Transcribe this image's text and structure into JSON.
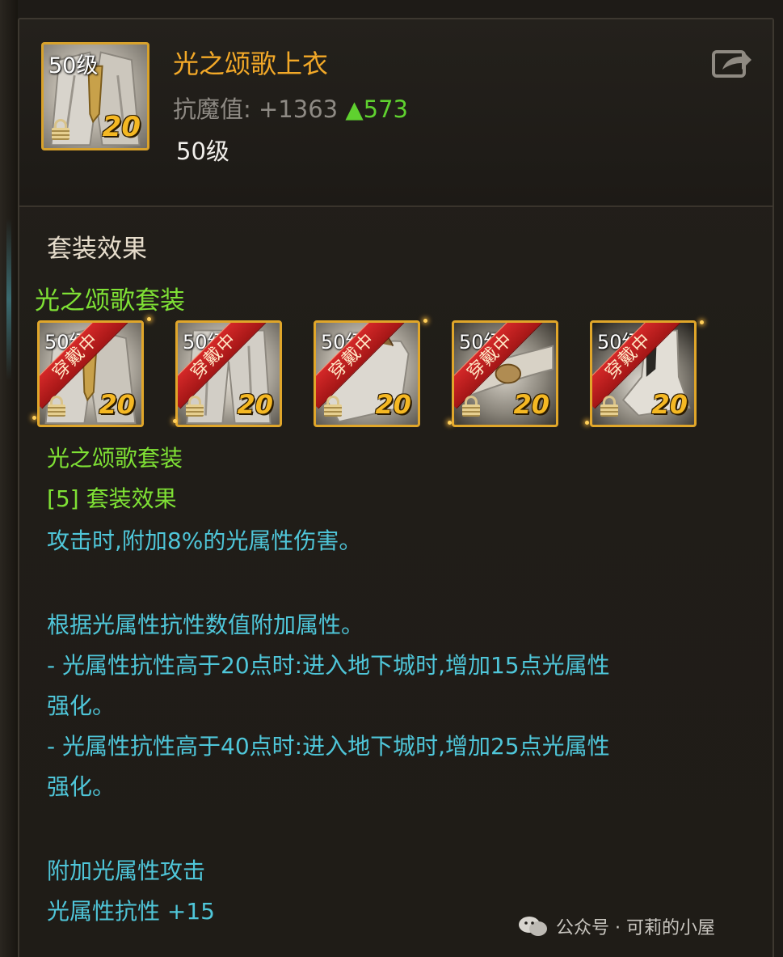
{
  "item": {
    "icon_level": "50级",
    "enhance": "20",
    "name": "光之颂歌上衣",
    "stat_label": "抗魔值:",
    "stat_value": "+1363",
    "stat_delta": "▲573",
    "level": "50级"
  },
  "set_section": {
    "title": "套装效果",
    "set_name": "光之颂歌套装",
    "slots": [
      {
        "level": "50级",
        "badge": "穿戴中",
        "enhance": "20",
        "icon": "coat-icon"
      },
      {
        "level": "50级",
        "badge": "穿戴中",
        "enhance": "20",
        "icon": "pants-icon"
      },
      {
        "level": "50级",
        "badge": "穿戴中",
        "enhance": "20",
        "icon": "shoulder-icon"
      },
      {
        "level": "50级",
        "badge": "穿戴中",
        "enhance": "20",
        "icon": "belt-icon"
      },
      {
        "level": "50级",
        "badge": "穿戴中",
        "enhance": "20",
        "icon": "boots-icon"
      }
    ]
  },
  "description": {
    "set_name": "光之颂歌套装",
    "effect_header": "[5] 套装效果",
    "line1": "攻击时,附加8%的光属性伤害。",
    "line2": "根据光属性抗性数值附加属性。",
    "line3a": "- 光属性抗性高于20点时:进入地下城时,增加15点光属性",
    "line3b": "强化。",
    "line4a": "- 光属性抗性高于40点时:进入地下城时,增加25点光属性",
    "line4b": "强化。",
    "line5": "附加光属性攻击",
    "line6": "光属性抗性 +15"
  },
  "watermark": {
    "text": "公众号 · 可莉的小屋"
  },
  "colors": {
    "item_name": "#f3a928",
    "set_green": "#7fe135",
    "desc_cyan": "#4fc6d9",
    "frame_gold": "#e0a62a",
    "ribbon_red": "#c41e1e"
  }
}
